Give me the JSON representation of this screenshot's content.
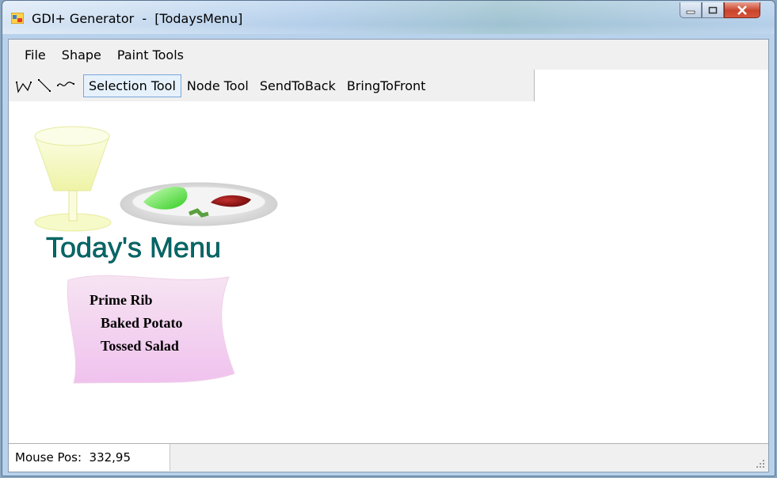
{
  "window": {
    "title": "GDI+ Generator  -  [TodaysMenu]",
    "icon": "app-icon"
  },
  "menubar": {
    "items": [
      {
        "label": "File"
      },
      {
        "label": "Shape"
      },
      {
        "label": "Paint Tools"
      }
    ]
  },
  "toolbar": {
    "icons": [
      "polyline-icon",
      "line-icon",
      "curve-icon"
    ],
    "buttons": [
      {
        "label": "Selection Tool",
        "selected": true
      },
      {
        "label": "Node Tool"
      },
      {
        "label": "SendToBack"
      },
      {
        "label": "BringToFront"
      }
    ]
  },
  "canvas": {
    "heading": "Today's Menu",
    "menu_items": [
      "Prime Rib",
      "Baked Potato",
      "Tossed Salad"
    ],
    "colors": {
      "heading": "#006666",
      "banner_top": "#f4dcef",
      "banner_bottom": "#f2c4ee",
      "glass": "#f4f7c0",
      "salad": "#55dd44",
      "meat": "#8a1010"
    }
  },
  "status": {
    "text": "Mouse Pos:  332,95"
  }
}
